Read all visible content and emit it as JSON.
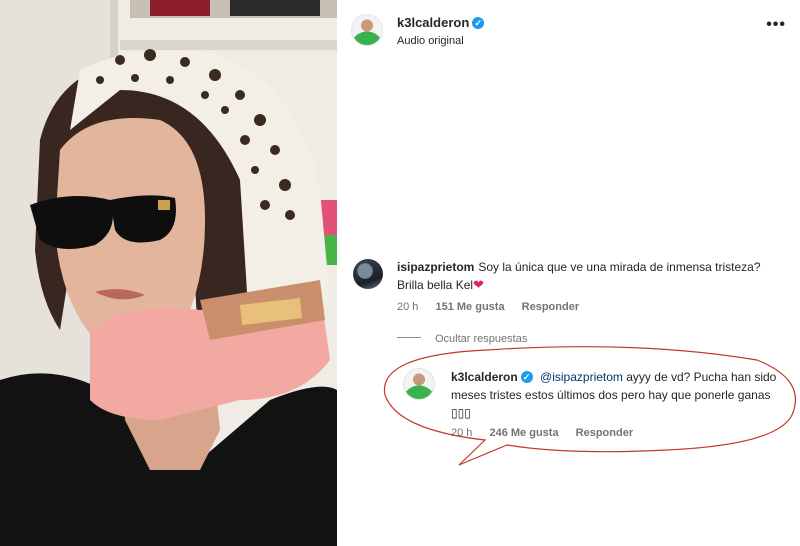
{
  "post": {
    "username": "k3lcalderon",
    "subtitle": "Audio original",
    "more_icon": "more-horizontal-icon"
  },
  "comments": [
    {
      "username": "isipazprietom",
      "text": "Soy la única que ve una mirada de inmensa tristeza? Brilla bella Kel",
      "emoji": "❤",
      "time": "20 h",
      "likes": "151 Me gusta",
      "reply": "Responder"
    }
  ],
  "hide_replies": "Ocultar respuestas",
  "reply": {
    "username": "k3lcalderon",
    "mention": "@isipazprietom",
    "text": " ayyy de vd? Pucha han sido meses tristes estos últimos dos pero hay que ponerle ganas ▯▯▯",
    "time": "20 h",
    "likes": "246 Me gusta",
    "reply": "Responder"
  },
  "colors": {
    "verified": "#1d9bf0",
    "annotation_ellipse": "#c0392b",
    "heart": "#e0245e"
  }
}
